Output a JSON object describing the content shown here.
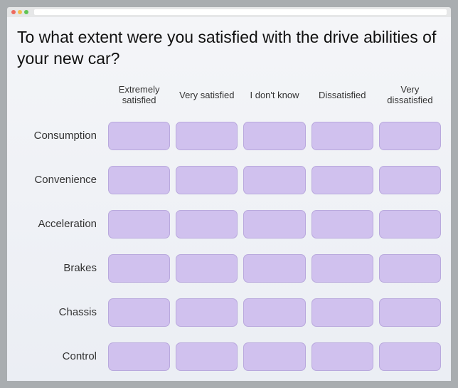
{
  "question": "To what extent were you satisfied with the drive abilities of your new car?",
  "columns": [
    "Extremely satisfied",
    "Very satisfied",
    "I don't know",
    "Dissatisfied",
    "Very dissatisfied"
  ],
  "rows": [
    "Consumption",
    "Convenience",
    "Acceleration",
    "Brakes",
    "Chassis",
    "Control"
  ],
  "colors": {
    "cell_fill": "#d0c1ee",
    "cell_border": "#b9a9dd",
    "page_bg_top": "#f4f5f8",
    "page_bg_bottom": "#ebeef4",
    "outer_bg": "#a9adb0"
  }
}
